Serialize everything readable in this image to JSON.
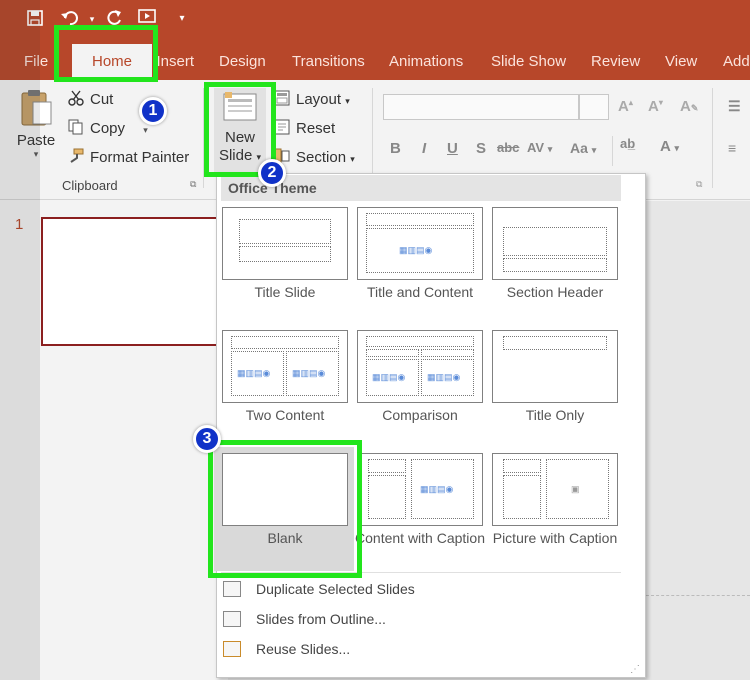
{
  "ribbon_tabs": [
    "File",
    "Home",
    "Insert",
    "Design",
    "Transitions",
    "Animations",
    "Slide Show",
    "Review",
    "View",
    "Add-ins"
  ],
  "active_tab": "Home",
  "clipboard": {
    "paste_label": "Paste",
    "cut_label": "Cut",
    "copy_label": "Copy",
    "format_painter_label": "Format Painter",
    "group_label": "Clipboard"
  },
  "slides": {
    "new_slide_line1": "New",
    "new_slide_line2": "Slide",
    "layout_label": "Layout",
    "reset_label": "Reset",
    "section_label": "Section"
  },
  "font_group": {
    "bold": "B",
    "italic": "I",
    "underline": "U",
    "strike": "abc",
    "spacing": "AV",
    "case": "Aa"
  },
  "thumbnail_pane": {
    "slide_number": "1"
  },
  "layout_menu": {
    "header": "Office Theme",
    "layouts": [
      "Title Slide",
      "Title and Content",
      "Section Header",
      "Two Content",
      "Comparison",
      "Title Only",
      "Blank",
      "Content with Caption",
      "Picture with Caption"
    ],
    "commands": [
      "Duplicate Selected Slides",
      "Slides from Outline...",
      "Reuse Slides..."
    ]
  },
  "callouts": [
    "1",
    "2",
    "3"
  ],
  "colors": {
    "accent": "#b7472a",
    "highlight": "#22e51c",
    "badge": "#1032c8"
  }
}
